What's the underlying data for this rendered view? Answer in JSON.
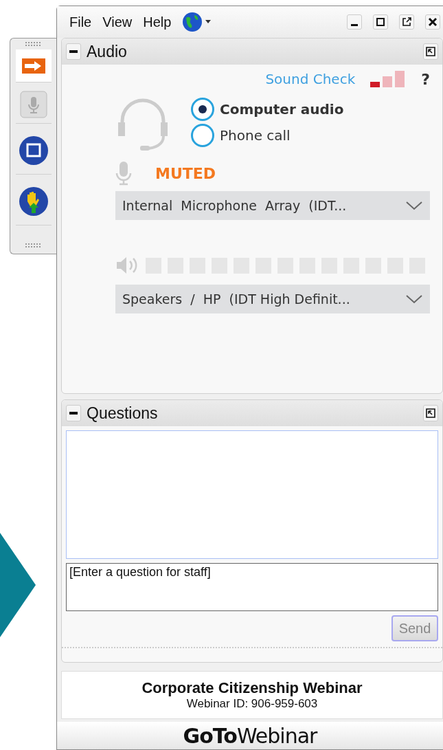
{
  "menu": [
    "File",
    "View",
    "Help"
  ],
  "audio": {
    "title": "Audio",
    "sound_check": "Sound Check",
    "help": "?",
    "options": [
      {
        "label": "Computer audio",
        "selected": true
      },
      {
        "label": "Phone call",
        "selected": false
      }
    ],
    "mic_status": "MUTED",
    "microphone": "Internal  Microphone  Array  (IDT...",
    "speaker_meter": {
      "level": 0
    },
    "speakers": "Speakers  /  HP  (IDT High Definit..."
  },
  "questions": {
    "title": "Questions",
    "placeholder": "[Enter a question for staff]",
    "send": "Send"
  },
  "footer": {
    "title": "Corporate Citizenship Webinar",
    "webinar_id": "Webinar ID: 906-959-603",
    "logo": "**GoTo**Webinar"
  }
}
